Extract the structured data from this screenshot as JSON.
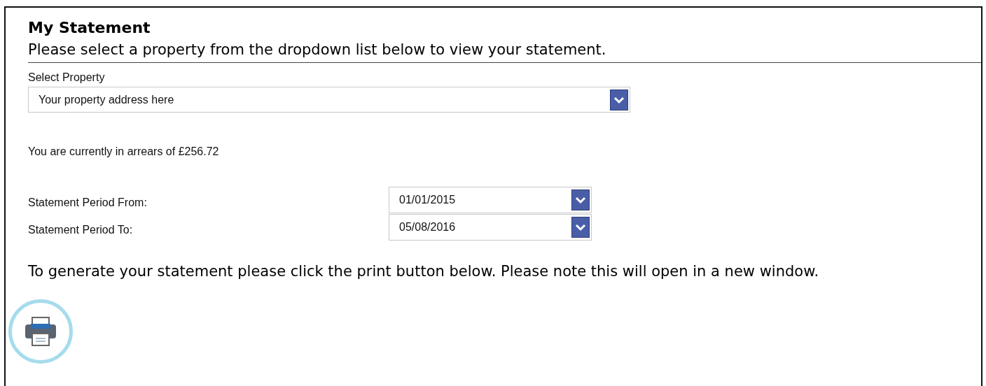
{
  "title": "My Statement",
  "intro": "Please select a property from the dropdown list below to view your statement.",
  "property": {
    "label": "Select Property",
    "value": "Your property address here"
  },
  "arrears": "You are currently in arrears of £256.72",
  "period": [
    {
      "label": "Statement Period From:",
      "value": "01/01/2015"
    },
    {
      "label": "Statement Period To:",
      "value": "05/08/2016"
    }
  ],
  "instruction": "To generate your statement please click the print button below. Please note this will open in a new window."
}
